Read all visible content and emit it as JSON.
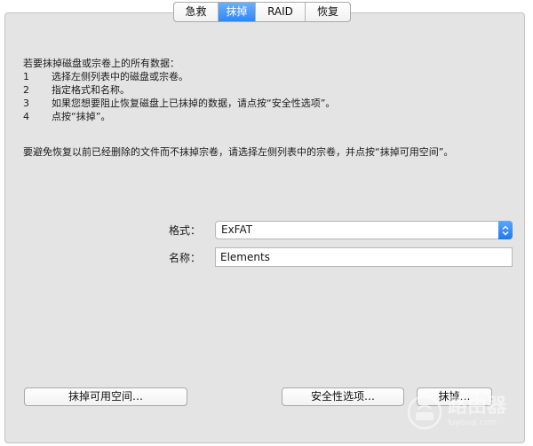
{
  "tabs": [
    {
      "label": "急救",
      "active": false
    },
    {
      "label": "抹掉",
      "active": true
    },
    {
      "label": "RAID",
      "active": false
    },
    {
      "label": "恢复",
      "active": false
    }
  ],
  "instructions": {
    "intro": "若要抹掉磁盘或宗卷上的所有数据：",
    "steps": [
      {
        "num": "1",
        "text": "选择左侧列表中的磁盘或宗卷。"
      },
      {
        "num": "2",
        "text": "指定格式和名称。"
      },
      {
        "num": "3",
        "text": "如果您想要阻止恢复磁盘上已抹掉的数据，请点按“安全性选项”。"
      },
      {
        "num": "4",
        "text": "点按“抹掉”。"
      }
    ],
    "erase_free_note": "要避免恢复以前已经删除的文件而不抹掉宗卷，请选择左侧列表中的宗卷，并点按“抹掉可用空间”。"
  },
  "form": {
    "format_label": "格式：",
    "format_value": "ExFAT",
    "name_label": "名称：",
    "name_value": "Elements"
  },
  "buttons": {
    "erase_free_space": "抹掉可用空间…",
    "security_options": "安全性选项…",
    "erase": "抹掉…"
  },
  "watermark": {
    "text_cn": "路由器",
    "text_en": "luyouqi.com",
    "icon": "router-icon"
  },
  "colors": {
    "accent": "#2f86f3",
    "panel": "#e4e4e4"
  }
}
